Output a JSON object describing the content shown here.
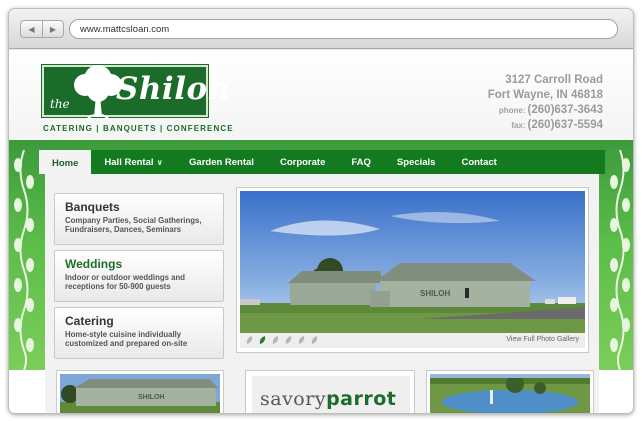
{
  "browser": {
    "url": "www.mattcsloan.com",
    "back_icon": "back-arrow-icon",
    "forward_icon": "forward-arrow-icon"
  },
  "logo": {
    "the": "the",
    "name": "Shiloh",
    "tagline": "CATERING | BANQUETS | CONFERENCE"
  },
  "contact": {
    "street": "3127 Carroll Road",
    "city": "Fort Wayne, IN 46818",
    "phone_label": "phone:",
    "phone": "(260)637-3643",
    "fax_label": "fax:",
    "fax": "(260)637-5594"
  },
  "nav": {
    "items": [
      {
        "label": "Home"
      },
      {
        "label": "Hall Rental"
      },
      {
        "label": "Garden Rental"
      },
      {
        "label": "Corporate"
      },
      {
        "label": "FAQ"
      },
      {
        "label": "Specials"
      },
      {
        "label": "Contact"
      }
    ],
    "active_index": 0,
    "dropdown_icon": "chevron-down-icon"
  },
  "promos": [
    {
      "title": "Banquets",
      "desc": "Company Parties, Social Gatherings, Fundraisers, Dances, Seminars"
    },
    {
      "title": "Weddings",
      "desc": "Indoor or outdoor weddings and receptions for 50-900 guests"
    },
    {
      "title": "Catering",
      "desc": "Home-style cuisine individually customized and prepared on-site"
    }
  ],
  "slideshow": {
    "building_sign": "SHILOH",
    "gallery_link": "View Full Photo Gallery",
    "dot_count": 6,
    "active_dot": 1
  },
  "thumbnails": {
    "sign_text": "SHILOH",
    "sponsor_prefix": "savory",
    "sponsor_suffix": "parrot"
  },
  "colors": {
    "brand_green": "#1b6b2a",
    "nav_green": "#137a20",
    "band_green": "#5cbd49",
    "address_gray": "#9b9b9b"
  }
}
